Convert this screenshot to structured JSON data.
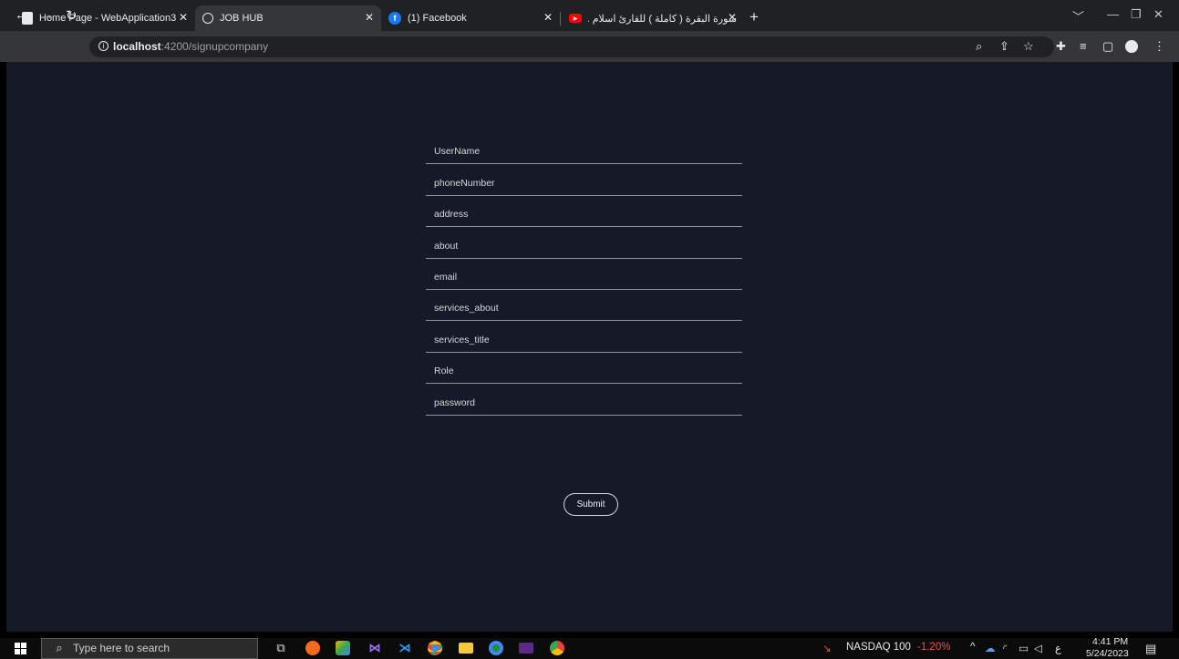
{
  "browser": {
    "tabs": [
      {
        "title": "Home Page - WebApplication3",
        "favicon": "document-icon"
      },
      {
        "title": "JOB HUB",
        "favicon": "globe-icon"
      },
      {
        "title": "(1) Facebook",
        "favicon": "facebook-icon"
      },
      {
        "title": "سورة البقرة ( كاملة ) للقارئ اسلام ...",
        "favicon": "youtube-icon"
      }
    ],
    "url_host": "localhost",
    "url_path": ":4200/signupcompany"
  },
  "form": {
    "fields": [
      {
        "placeholder": "UserName"
      },
      {
        "placeholder": "phoneNumber"
      },
      {
        "placeholder": "address"
      },
      {
        "placeholder": "about"
      },
      {
        "placeholder": "email"
      },
      {
        "placeholder": "services_about"
      },
      {
        "placeholder": "services_title"
      },
      {
        "placeholder": "Role"
      },
      {
        "placeholder": "password"
      }
    ],
    "submit_label": "Submit"
  },
  "taskbar": {
    "search_placeholder": "Type here to search",
    "stock_name": "NASDAQ 100",
    "stock_change": "-1.20%",
    "input_lang": "ع",
    "time": "4:41 PM",
    "date": "5/24/2023"
  },
  "colors": {
    "page_bg": "#161927",
    "stock_negative": "#ff4d4d"
  }
}
